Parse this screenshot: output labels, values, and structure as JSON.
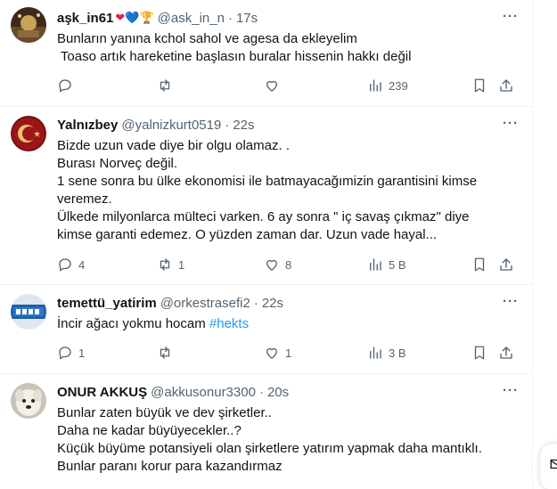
{
  "tweets": [
    {
      "name": "aşk_in61",
      "name_emoji": "❤💙🏆",
      "handle": "@ask_in_n",
      "time": "17s",
      "lines": [
        "Bunların yanına kchol sahol ve agesa da ekleyelim",
        " Toaso artık hareketine başlasın buralar hissenin hakkı değil"
      ],
      "replies": "",
      "retweets": "",
      "likes": "",
      "views": "239"
    },
    {
      "name": "Yalnızbey",
      "handle": "@yalnizkurt0519",
      "time": "22s",
      "lines": [
        "Bizde uzun vade diye bir olgu olamaz. .",
        "Burası Norveç değil.",
        "1 sene sonra bu ülke ekonomisi ile batmayacağımizin garantisini kimse",
        "veremez.",
        "Ülkede milyonlarca mülteci varken. 6 ay sonra \" iç savaş çıkmaz\" diye",
        "kimse garanti edemez. O yüzden zaman dar. Uzun vade hayal..."
      ],
      "replies": "4",
      "retweets": "1",
      "likes": "8",
      "views": "5 B"
    },
    {
      "name": "temettü_yatirim",
      "handle": "@orkestrasefi2",
      "time": "22s",
      "text_before": "İncir ağacı yokmu hocam ",
      "hashtag": "#hekts",
      "replies": "1",
      "retweets": "",
      "likes": "1",
      "views": "3 B"
    },
    {
      "name": "ONUR AKKUŞ",
      "handle": "@akkusonur3300",
      "time": "20s",
      "lines": [
        "Bunlar zaten büyük ve dev şirketler..",
        "Daha ne kadar büyüyecekler..?",
        "Küçük büyüme potansiyeli olan şirketlere yatırım yapmak daha mantıklı.",
        "Bunlar paranı korur para kazandırmaz"
      ]
    }
  ],
  "more_label": "···",
  "dot": "·",
  "icons": {
    "reply": "reply-icon",
    "retweet": "retweet-icon",
    "like": "like-icon",
    "views": "views-icon",
    "bookmark": "bookmark-icon",
    "share": "share-icon"
  },
  "colors": {
    "link": "#1d9bf0",
    "secondary": "#536471",
    "text": "#0f1419",
    "divider": "#eff3f4"
  }
}
